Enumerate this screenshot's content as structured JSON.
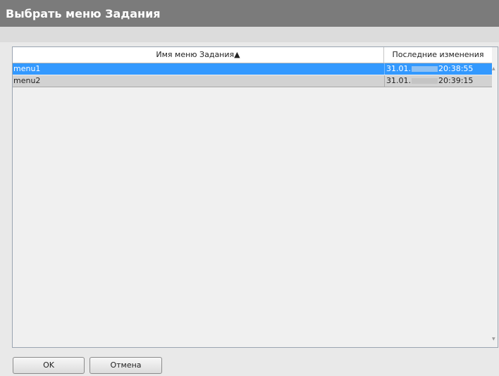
{
  "window": {
    "title": "Выбрать меню Задания"
  },
  "table": {
    "columns": [
      "Имя меню Задания▲",
      "Последние изменения"
    ],
    "rows": [
      {
        "name": "menu1",
        "date_prefix": "31.01.",
        "time": "20:38:55",
        "selected": true
      },
      {
        "name": "menu2",
        "date_prefix": "31.01.",
        "time": "20:39:15",
        "selected": false
      }
    ]
  },
  "buttons": {
    "ok": "OK",
    "cancel": "Отмена"
  },
  "colors": {
    "titlebar": "#7b7b7b",
    "selection": "#3399ff"
  }
}
